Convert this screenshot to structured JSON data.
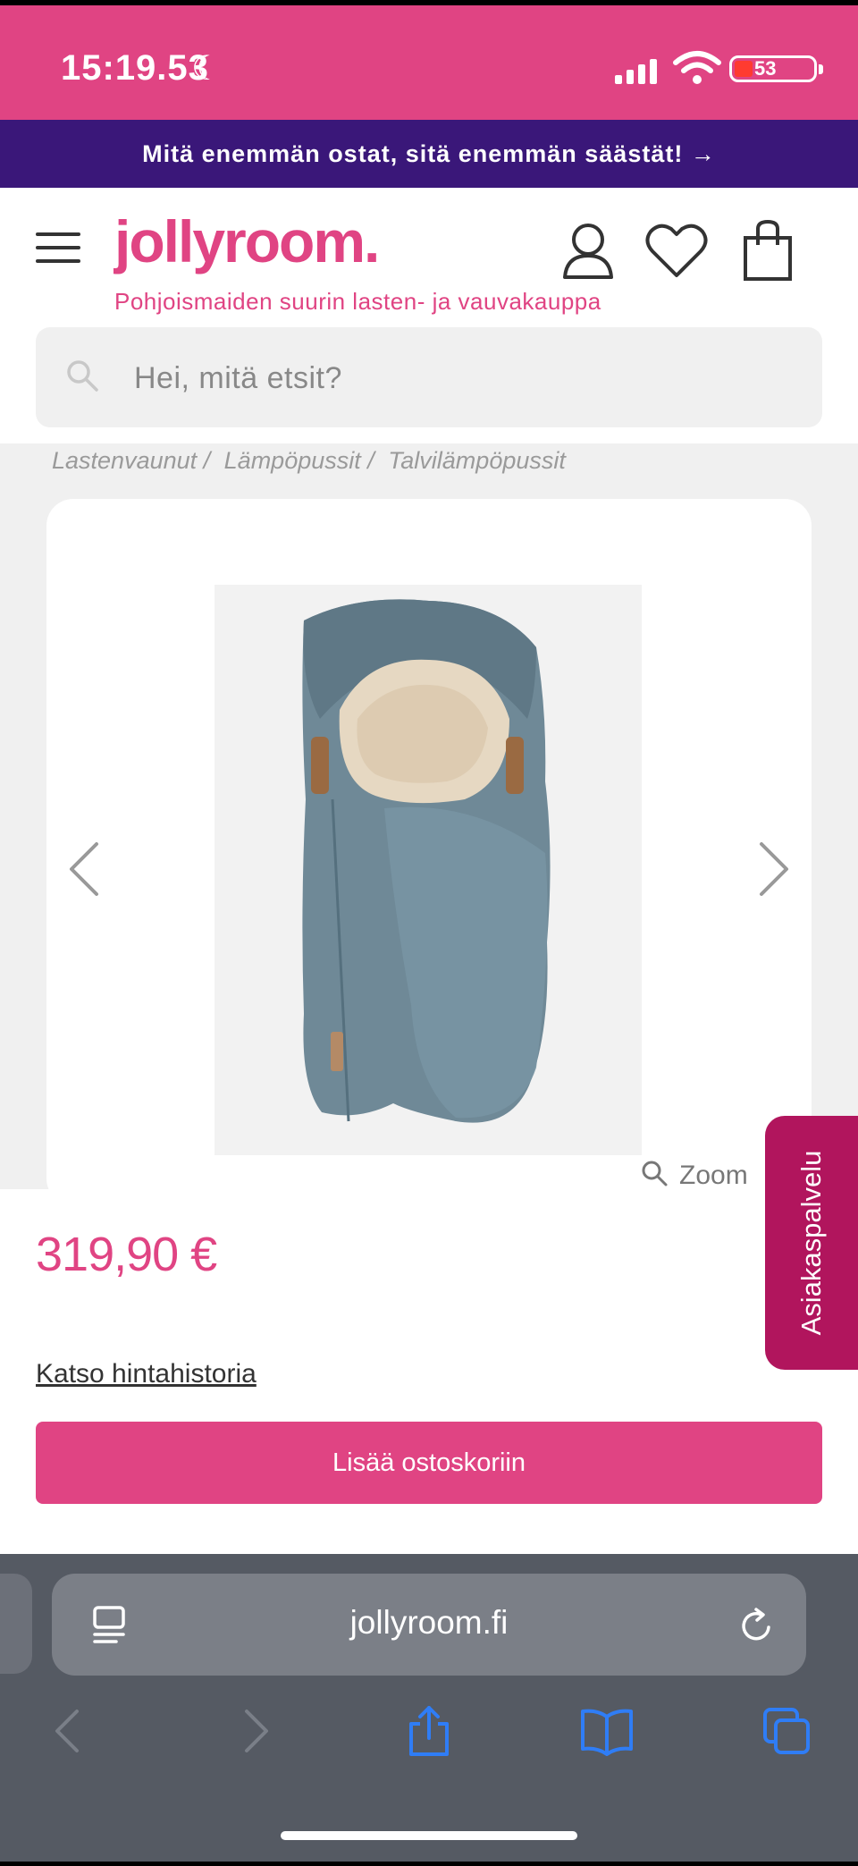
{
  "status_bar": {
    "time": "15:19.53",
    "battery_level": "53",
    "colors": {
      "background": "#e04483",
      "battery_low": "#ff3b30"
    }
  },
  "promo_banner": {
    "text": "Mitä enemmän ostat, sitä enemmän säästät! →",
    "background": "#3a1779"
  },
  "header": {
    "logo": "jollyroom.",
    "tagline": "Pohjoismaiden suurin lasten- ja vauvakauppa",
    "icons": [
      "menu-icon",
      "account-icon",
      "wishlist-icon",
      "cart-icon"
    ],
    "brand_color": "#e04483"
  },
  "search": {
    "placeholder": "Hei, mitä etsit?"
  },
  "breadcrumb": {
    "items": [
      "Lastenvaunut /",
      "Lämpöpussit /",
      "Talvilämpöpussit"
    ]
  },
  "product": {
    "image_alt": "footmuff",
    "zoom_label": "Zoom",
    "price": "319,90 €",
    "price_history_link": "Katso hintahistoria",
    "add_to_cart_label": "Lisää ostoskoriin"
  },
  "support_tab": {
    "label": "Asiakaspalvelu",
    "color": "#b1155d"
  },
  "browser": {
    "url": "jollyroom.fi",
    "toolbar_icons": [
      "back-icon",
      "forward-icon",
      "share-icon",
      "bookmarks-icon",
      "tabs-icon"
    ],
    "accent": "#2f7df6"
  }
}
